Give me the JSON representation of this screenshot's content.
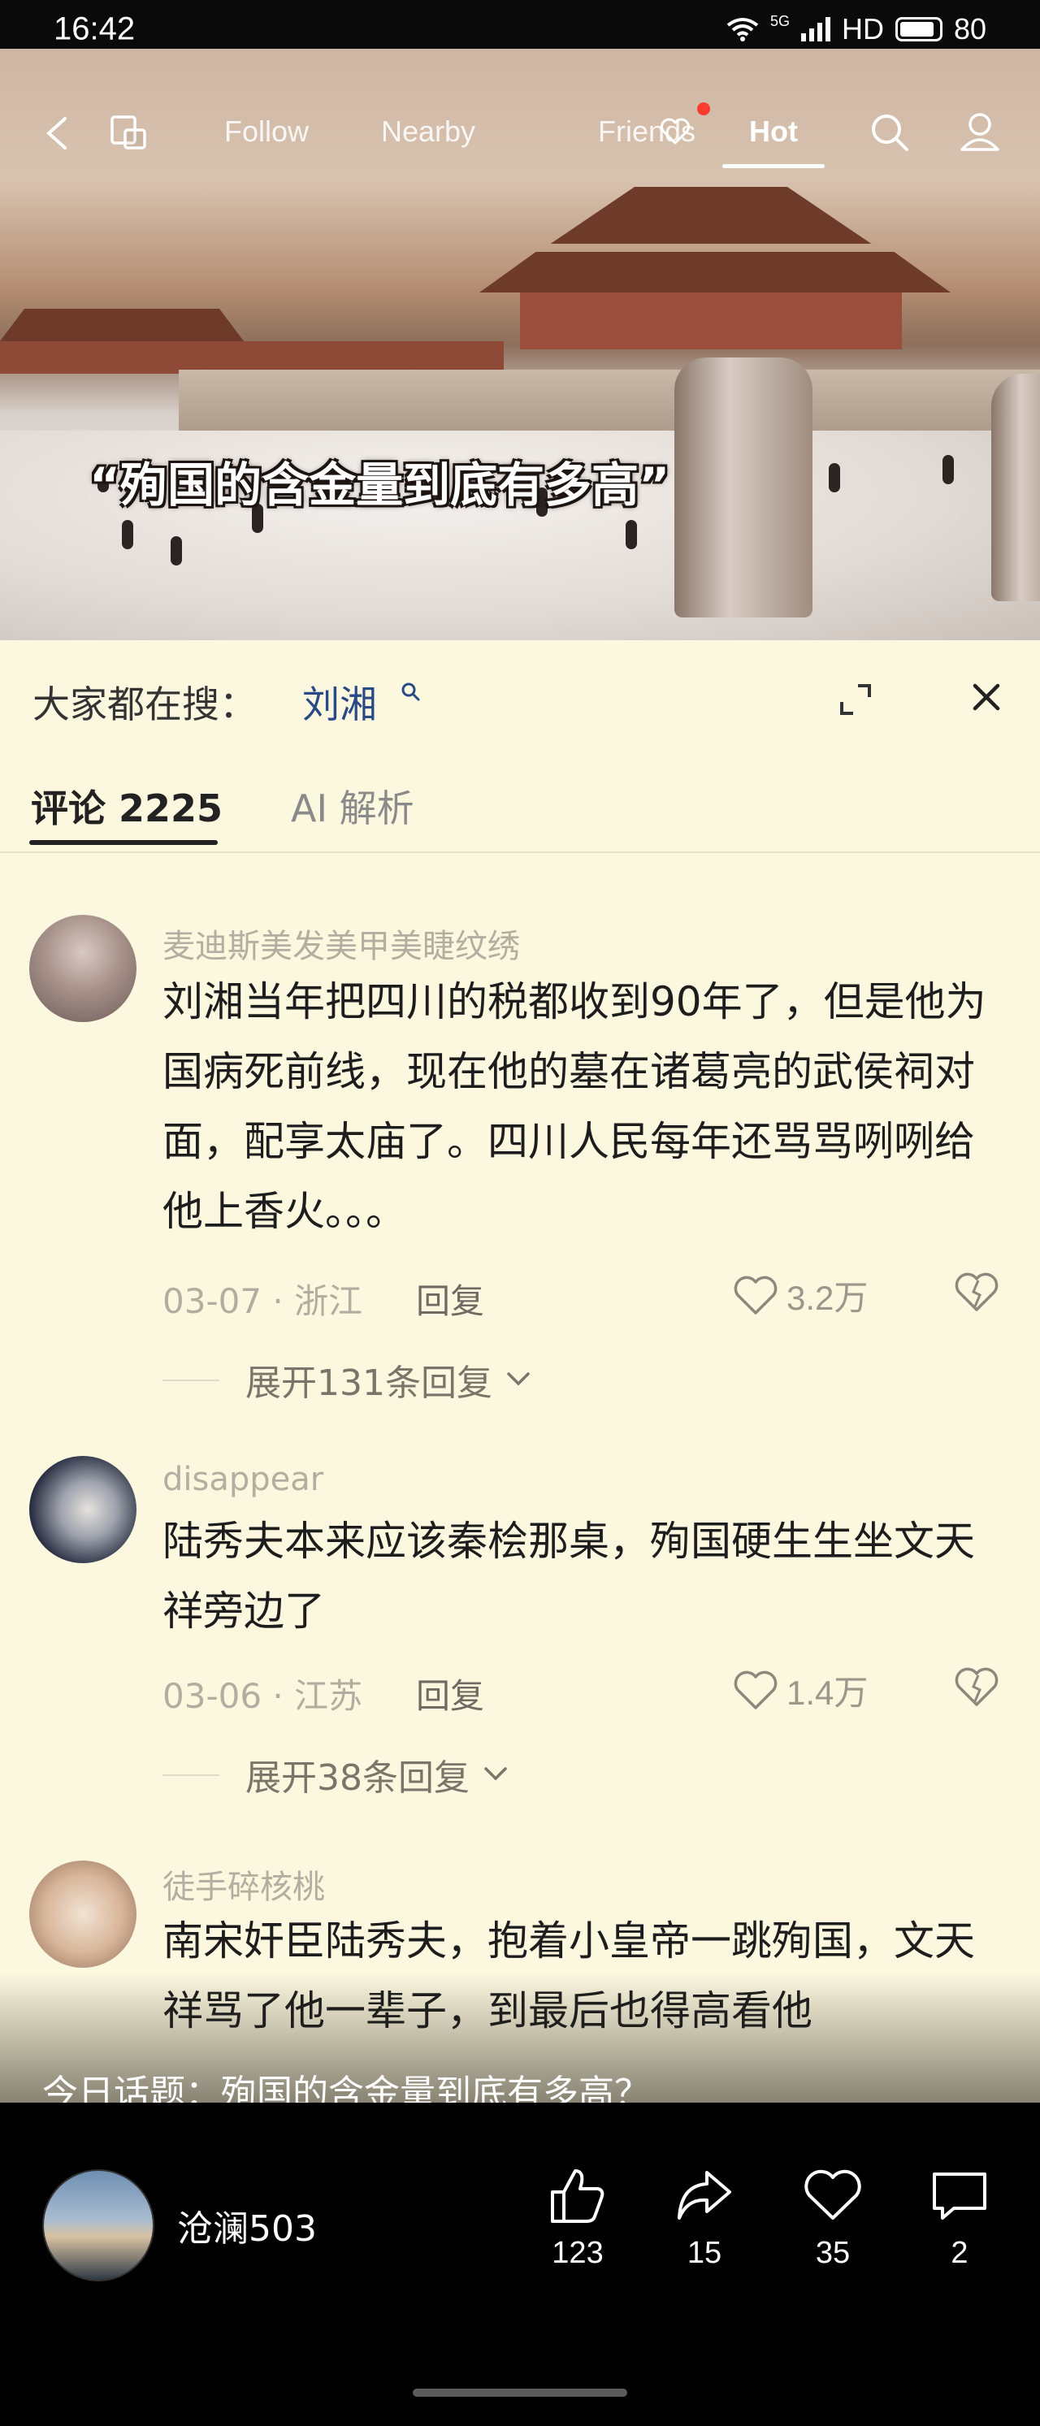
{
  "status_bar": {
    "time": "16:42",
    "network": "5G",
    "hd": "HD",
    "battery": "80"
  },
  "nav": {
    "tabs": [
      {
        "label": "Follow",
        "active": false
      },
      {
        "label": "Nearby",
        "active": false
      },
      {
        "label": "Friends",
        "active": false,
        "badge": "red-dot"
      },
      {
        "label": "Hot",
        "active": true
      }
    ],
    "icons": [
      "back-icon",
      "copy-icon",
      "heart-icon",
      "search-icon",
      "profile-icon"
    ]
  },
  "video": {
    "caption": "“殉国的含金量到底有多高”"
  },
  "search_suggest": {
    "prefix": "大家都在搜：",
    "term": "刘湘"
  },
  "tabs": [
    {
      "label": "评论 2225",
      "active": true
    },
    {
      "label": "AI 解析",
      "active": false
    }
  ],
  "comments": [
    {
      "user": "麦迪斯美发美甲美睫纹绣",
      "text": "刘湘当年把四川的税都收到90年了，但是他为国病死前线，现在他的墓在诸葛亮的武侯祠对面，配享太庙了。四川人民每年还骂骂咧咧给他上香火。。。",
      "date": "03-07",
      "location": "浙江",
      "reply_label": "回复",
      "likes": "3.2万",
      "expand": "展开131条回复"
    },
    {
      "user": "disappear",
      "text": "陆秀夫本来应该秦桧那桌，殉国硬生生坐文天祥旁边了",
      "date": "03-06",
      "location": "江苏",
      "reply_label": "回复",
      "likes": "1.4万",
      "expand": "展开38条回复"
    },
    {
      "user": "徒手碎核桃",
      "text": "南宋奸臣陆秀夫，抱着小皇帝一跳殉国，文天祥骂了他一辈子，到最后也得高看他"
    }
  ],
  "topic": "今日话题：殉国的含金量到底有多高？",
  "author": {
    "name": "沧澜503"
  },
  "actions": [
    {
      "name": "like",
      "count": "123"
    },
    {
      "name": "share",
      "count": "15"
    },
    {
      "name": "favorite",
      "count": "35"
    },
    {
      "name": "comment",
      "count": "2"
    }
  ],
  "colors": {
    "sheet_bg": "#fcf7df",
    "accent_red": "#ff3b30",
    "link_blue": "#2a4a86"
  }
}
